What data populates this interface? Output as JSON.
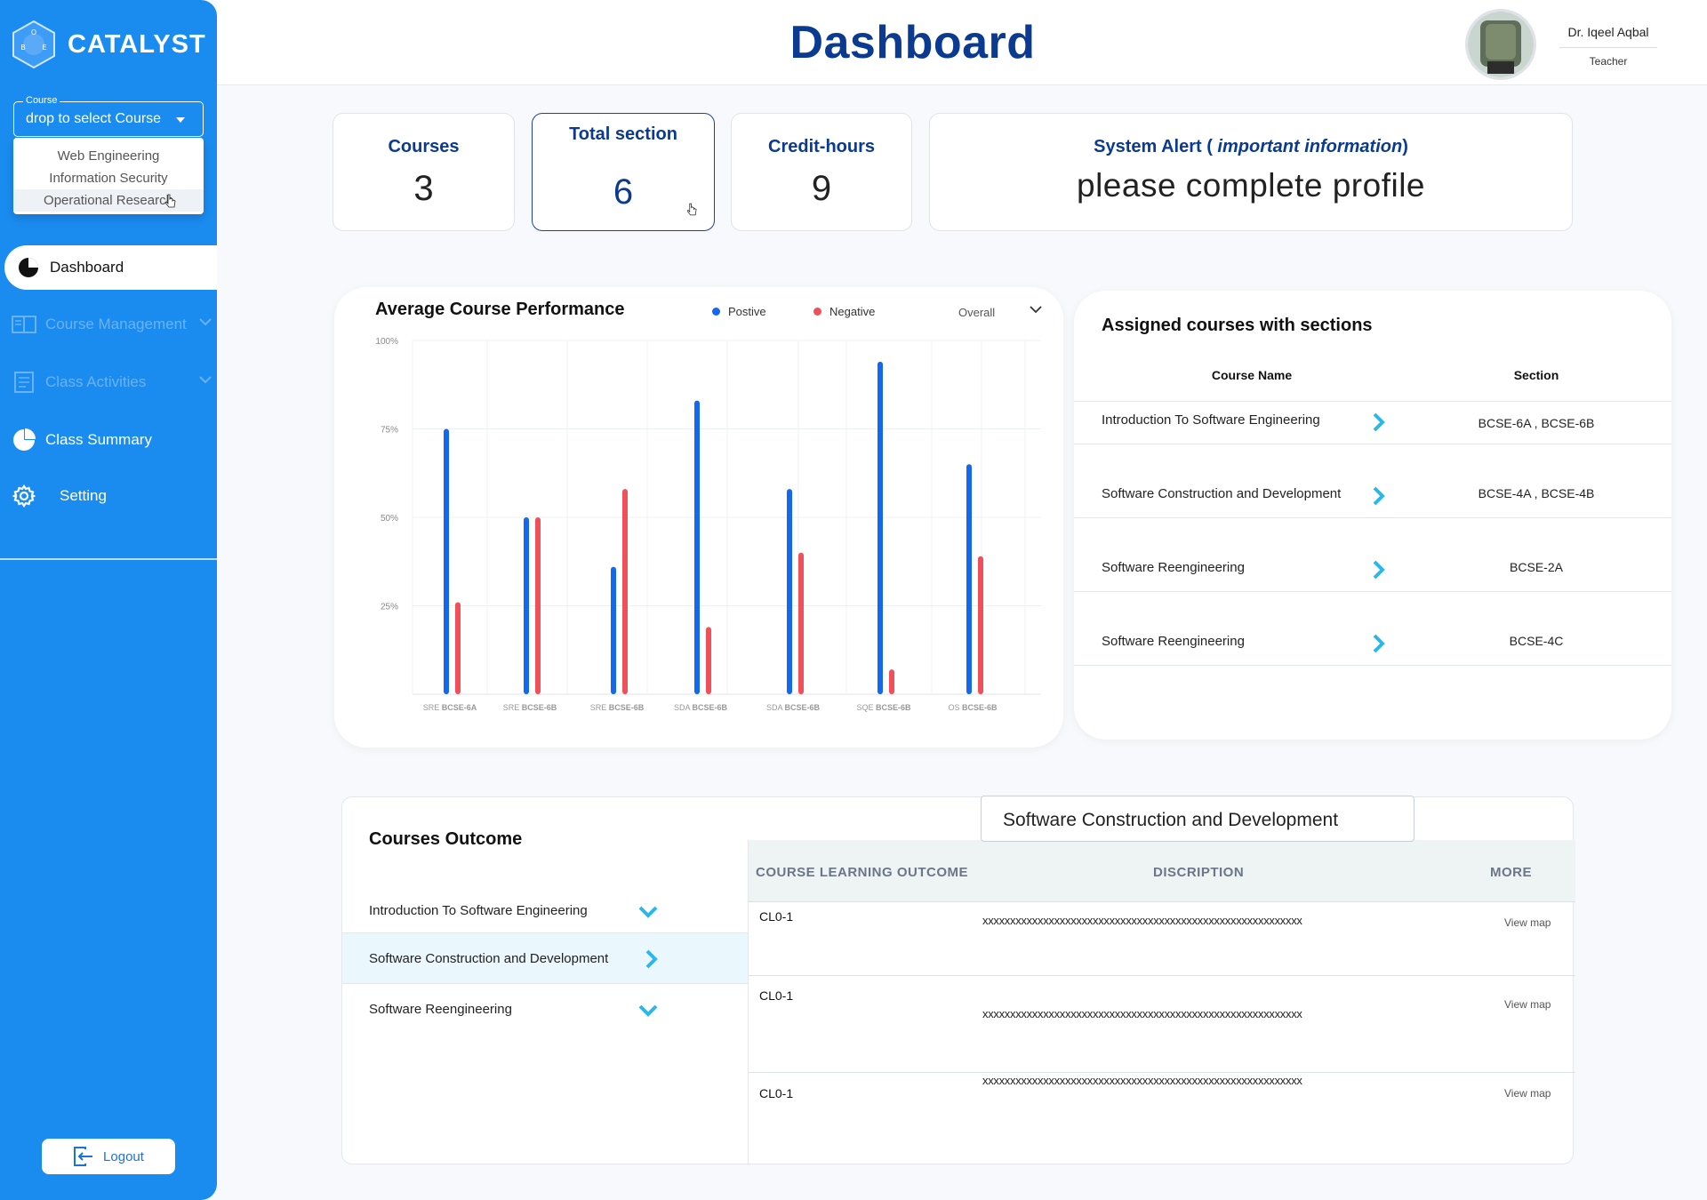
{
  "app": {
    "name": "CATALYST",
    "logo_letters": [
      "O",
      "B",
      "E"
    ]
  },
  "sidebar": {
    "course_select": {
      "legend": "Course",
      "value": "drop to select Course"
    },
    "dropdown_options": [
      "Web Engineering",
      "Information Security",
      "Operational Research"
    ],
    "items": [
      {
        "label": "Dashboard",
        "icon": "pie-chart-icon"
      },
      {
        "label": "Course Management",
        "icon": "book-icon"
      },
      {
        "label": "Class Activities",
        "icon": "document-icon"
      },
      {
        "label": "Class Summary",
        "icon": "pie-chart-icon"
      },
      {
        "label": "Setting",
        "icon": "gear-icon"
      }
    ],
    "logout_label": "Logout"
  },
  "header": {
    "title": "Dashboard",
    "user": {
      "name": "Dr. Iqeel Aqbal",
      "role": "Teacher"
    }
  },
  "stats": {
    "courses": {
      "label": "Courses",
      "value": "3"
    },
    "sections": {
      "label": "Total section",
      "value": "6"
    },
    "credit_hours": {
      "label": "Credit-hours",
      "value": "9"
    },
    "alert": {
      "title_prefix": "System Alert (",
      "title_emph": " important information",
      "title_suffix": ")",
      "message": "please complete profile"
    }
  },
  "performance": {
    "title": "Average Course Performance",
    "legend_positive": "Postive",
    "legend_negative": "Negative",
    "filter": "Overall"
  },
  "chart_data": {
    "type": "bar",
    "categories_prefix": [
      "SRE",
      "SRE",
      "SRE",
      "SDA",
      "SDA",
      "SQE",
      "OS"
    ],
    "categories_section": [
      "BCSE-6A",
      "BCSE-6B",
      "BCSE-6B",
      "BCSE-6B",
      "BCSE-6B",
      "BCSE-6B",
      "BCSE-6B"
    ],
    "categories": [
      "SRE BCSE-6A",
      "SRE BCSE-6B",
      "SRE BCSE-6B",
      "SDA BCSE-6B",
      "SDA BCSE-6B",
      "SQE BCSE-6B",
      "OS BCSE-6B"
    ],
    "series": [
      {
        "name": "Postive",
        "color": "#1467f0",
        "values": [
          75,
          50,
          36,
          83,
          58,
          94,
          65
        ]
      },
      {
        "name": "Negative",
        "color": "#f0505a",
        "values": [
          26,
          50,
          58,
          19,
          40,
          7,
          39
        ]
      }
    ],
    "yticks": [
      "25%",
      "50%",
      "75%",
      "100%"
    ],
    "ylim": [
      0,
      100
    ],
    "grid": true,
    "legend_position": "top"
  },
  "assigned": {
    "title": "Assigned courses with sections",
    "columns": [
      "Course Name",
      "Section"
    ],
    "rows": [
      {
        "course": "Introduction To Software Engineering",
        "section": "BCSE-6A , BCSE-6B"
      },
      {
        "course": "Software Construction and Development",
        "section": "BCSE-4A , BCSE-4B"
      },
      {
        "course": "Software Reengineering",
        "section": "BCSE-2A"
      },
      {
        "course": "Software Reengineering",
        "section": "BCSE-4C"
      }
    ]
  },
  "outcome": {
    "title": "Courses Outcome",
    "courses": [
      {
        "label": "Introduction To Software Engineering",
        "state": "collapsed"
      },
      {
        "label": "Software Construction and Development",
        "state": "selected"
      },
      {
        "label": "Software Reengineering",
        "state": "collapsed"
      }
    ],
    "selected_course": "Software Construction and Development",
    "columns": [
      "COURSE LEARNING OUTCOME",
      "DISCRIPTION",
      "MORE"
    ],
    "rows": [
      {
        "clo": "CL0-1",
        "description": "xxxxxxxxxxxxxxxxxxxxxxxxxxxxxxxxxxxxxxxxxxxxxxxxxxxxxxxxxx",
        "more": "View map"
      },
      {
        "clo": "CL0-1",
        "description": "xxxxxxxxxxxxxxxxxxxxxxxxxxxxxxxxxxxxxxxxxxxxxxxxxxxxxxxxxx",
        "more": "View map"
      },
      {
        "clo": "CL0-1",
        "description": "xxxxxxxxxxxxxxxxxxxxxxxxxxxxxxxxxxxxxxxxxxxxxxxxxxxxxxxxxx",
        "more": "View map"
      }
    ]
  },
  "colors": {
    "sidebar": "#1a8cf0",
    "title_blue": "#0b3a91",
    "positive": "#1467f0",
    "negative": "#f0505a",
    "arrow": "#2bb8e8"
  }
}
